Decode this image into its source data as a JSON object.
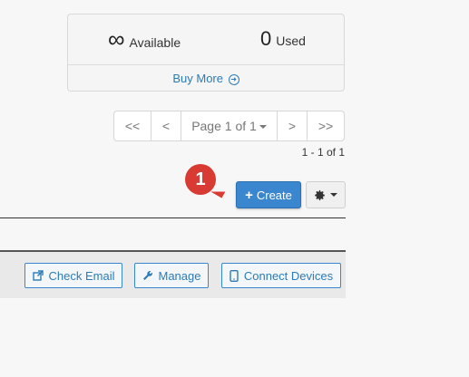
{
  "quota": {
    "available_value": "∞",
    "available_label": "Available",
    "used_value": "0",
    "used_label": "Used",
    "buy_more": "Buy More"
  },
  "pager": {
    "first": "<<",
    "prev": "<",
    "page": "Page 1 of 1",
    "next": ">",
    "last": ">>",
    "count_text": "1 - 1 of 1"
  },
  "badge": {
    "number": "1"
  },
  "toolbar": {
    "create_label": "Create"
  },
  "actions": {
    "check_email": "Check Email",
    "manage": "Manage",
    "connect_devices": "Connect Devices"
  },
  "colors": {
    "primary": "#3a87cf",
    "link": "#2c7bb6",
    "badge": "#d83a34"
  }
}
